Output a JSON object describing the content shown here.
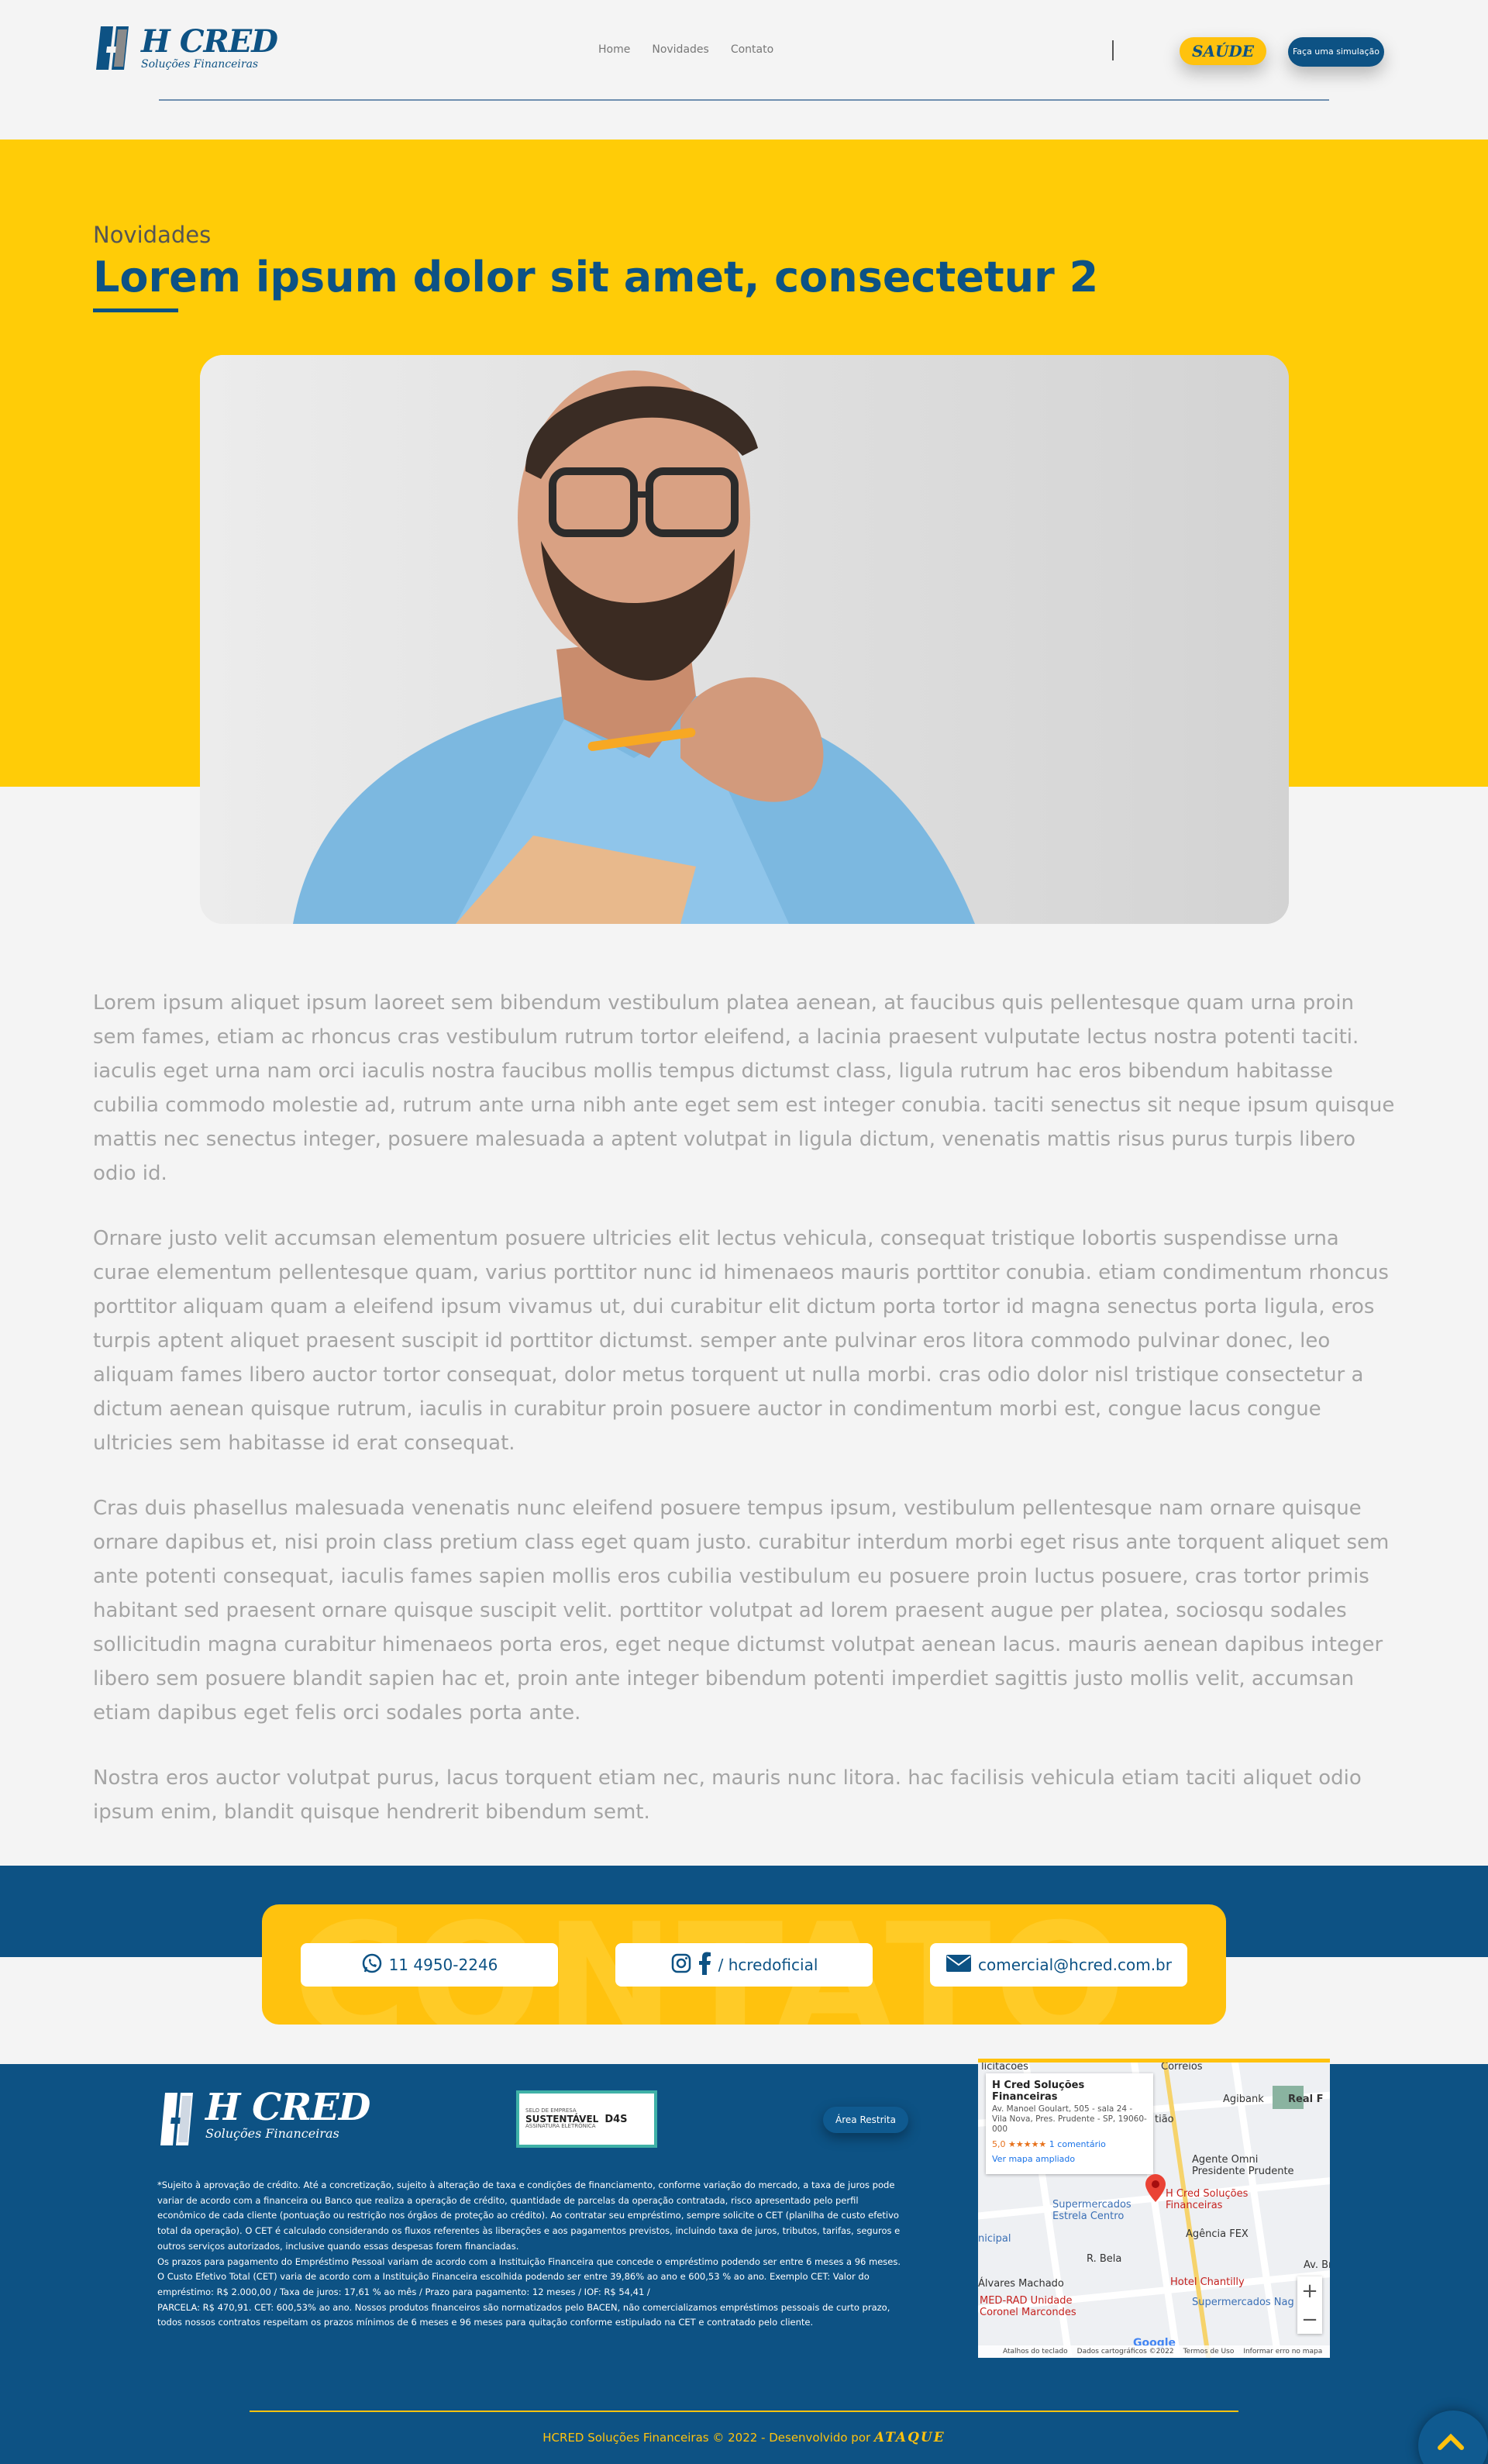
{
  "header": {
    "logo_name": "H CRED",
    "logo_sub": "Soluções Financeiras",
    "nav": [
      "Home",
      "Novidades",
      "Contato"
    ],
    "saude_label": "SAÚDE",
    "simulacao_label": "Faça uma simulação"
  },
  "hero": {
    "kicker": "Novidades",
    "title": "Lorem ipsum dolor sit amet, consectetur 2"
  },
  "content": {
    "paragraphs": [
      "Lorem ipsum aliquet ipsum laoreet sem bibendum vestibulum platea aenean, at faucibus quis pellentesque quam urna proin sem fames, etiam ac rhoncus cras vestibulum rutrum tortor eleifend, a lacinia praesent vulputate lectus nostra potenti taciti. iaculis eget urna nam orci iaculis nostra faucibus mollis tempus dictumst class, ligula rutrum hac eros bibendum habitasse cubilia commodo molestie ad, rutrum ante urna nibh ante eget sem est integer conubia. taciti senectus sit neque ipsum quisque mattis nec senectus integer, posuere malesuada a aptent volutpat in ligula dictum, venenatis mattis risus purus turpis libero odio id.",
      "Ornare justo velit accumsan elementum posuere ultricies elit lectus vehicula, consequat tristique lobortis suspendisse urna curae elementum pellentesque quam, varius porttitor nunc id himenaeos mauris porttitor conubia. etiam condimentum rhoncus porttitor aliquam quam a eleifend ipsum vivamus ut, dui curabitur elit dictum porta tortor id magna senectus porta ligula, eros turpis aptent aliquet praesent suscipit id porttitor dictumst. semper ante pulvinar eros litora commodo pulvinar donec, leo aliquam fames libero auctor tortor consequat, dolor metus torquent ut nulla morbi. cras odio dolor nisl tristique consectetur a dictum aenean quisque rutrum, iaculis in curabitur proin posuere auctor in condimentum morbi est, congue lacus congue ultricies sem habitasse id erat consequat.",
      "Cras duis phasellus malesuada venenatis nunc eleifend posuere tempus ipsum, vestibulum pellentesque nam ornare quisque ornare dapibus et, nisi proin class pretium class eget quam justo. curabitur interdum morbi eget risus ante torquent aliquet sem ante potenti consequat, iaculis fames sapien mollis eros cubilia vestibulum eu posuere proin luctus posuere, cras tortor primis habitant sed praesent ornare quisque suscipit velit. porttitor volutpat ad lorem praesent augue per platea, sociosqu sodales sollicitudin magna curabitur himenaeos porta eros, eget neque dictumst volutpat aenean lacus. mauris aenean dapibus integer libero sem posuere blandit sapien hac et, proin ante integer bibendum potenti imperdiet sagittis justo mollis velit, accumsan etiam dapibus eget felis orci sodales porta ante.",
      "Nostra eros auctor volutpat purus, lacus torquent etiam nec, mauris nunc litora. hac facilisis vehicula etiam taciti aliquet odio ipsum enim, blandit quisque hendrerit bibendum semt."
    ]
  },
  "contact": {
    "watermark": "CONTATO",
    "phone": "11 4950-2246",
    "social": "/ hcredoficial",
    "email": "comercial@hcred.com.br"
  },
  "footer": {
    "logo_name": "H CRED",
    "logo_sub": "Soluções Financeiras",
    "seal_small1": "SELO DE EMPRESA",
    "seal_big": "SUSTENTÁVEL",
    "seal_small2": "ASSINATURA ELETRÔNICA",
    "seal_logo": "D4S",
    "area_restrita": "Área Restrita",
    "legal": [
      "*Sujeito à aprovação de crédito. Até a concretização, sujeito à alteração de taxa e condições de financiamento, conforme variação do mercado, a taxa de juros pode variar de acordo com a financeira ou Banco que realiza a operação de crédito, quantidade de parcelas da operação contratada, risco apresentado pelo perfil econômico de cada cliente (pontuação ou restrição nos órgãos de proteção ao crédito). Ao contratar seu empréstimo, sempre solicite o CET (planilha de custo efetivo total da operação). O CET é calculado considerando os fluxos referentes às liberações e aos pagamentos previstos, incluindo taxa de juros, tributos, tarifas, seguros e outros serviços autorizados, inclusive quando essas despesas forem financiadas.",
      "Os prazos para pagamento do Empréstimo Pessoal variam de acordo com a Instituição Financeira que concede o empréstimo podendo ser entre 6 meses a 96 meses. O Custo Efetivo Total (CET) varia de acordo com a Instituição Financeira escolhida podendo ser entre 39,86% ao ano e 600,53 % ao ano. Exemplo CET: Valor do empréstimo: R$ 2.000,00 / Taxa de juros: 17,61 % ao mês / Prazo para pagamento: 12 meses / IOF: R$ 54,41 /",
      "PARCELA: R$ 470,91. CET: 600,53% ao ano. Nossos produtos financeiros são normatizados pelo BACEN, não comercializamos empréstimos pessoais de curto prazo, todos nossos contratos respeitam os prazos mínimos de 6 meses e 96 meses para quitação conforme estipulado na CET e contratado pelo cliente."
    ],
    "copyright": "HCRED Soluções Financeiras © 2022 - Desenvolvido por",
    "dev": "ATAQUE"
  },
  "map": {
    "title": "H Cred Soluções Financeiras",
    "address": "Av. Manoel Goulart, 505 - sala 24 - Vila Nova, Pres. Prudente - SP, 19060-000",
    "rating": "5,0 ★★★★★",
    "comments": "1 comentário",
    "link": "Ver mapa ampliado",
    "labels": [
      "Agibank",
      "Real F",
      "Agente Omni Presidente Prudente",
      "H Cred Soluções Financeiras",
      "Supermercados Estrela Centro",
      "Agência FEX",
      "Hotel Chantilly",
      "Supermercados Nag",
      "MED-RAD Unidade Coronel Marcondes",
      "Álvares Machado",
      "Correios",
      "licitacoes",
      "nicipal",
      "R. Bela",
      "Av. Br",
      "tião"
    ],
    "attribution": [
      "Atalhos do teclado",
      "Dados cartográficos ©2022",
      "Termos de Uso",
      "Informar erro no mapa"
    ],
    "google": "Google"
  }
}
